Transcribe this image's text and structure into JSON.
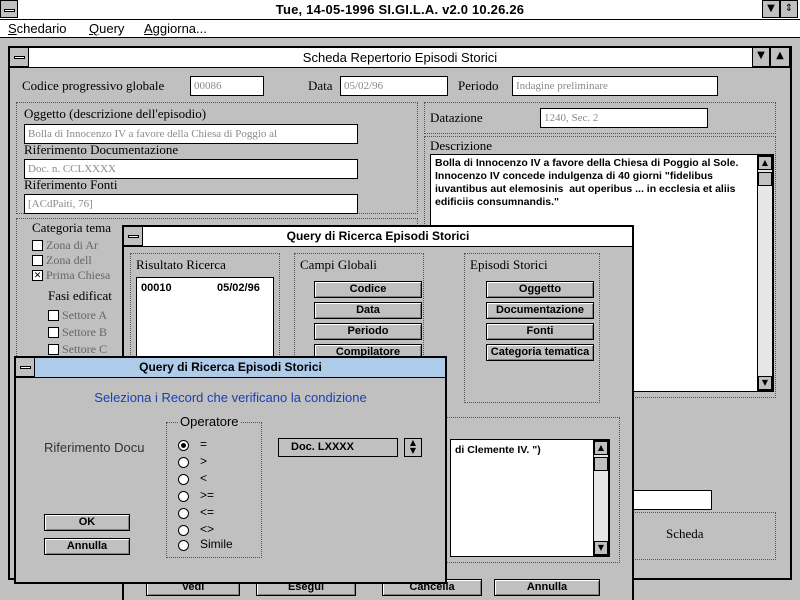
{
  "app": {
    "title": "Tue, 14-05-1996   SI.GI.L.A.  v2.0   10.26.26"
  },
  "menu": [
    "Schedario",
    "Query",
    "Aggiorna..."
  ],
  "main": {
    "title": "Scheda Repertorio Episodi Storici",
    "codice_label": "Codice progressivo globale",
    "codice_value": "00086",
    "data_label": "Data",
    "data_value": "05/02/96",
    "periodo_label": "Periodo",
    "periodo_value": "Indagine preliminare",
    "oggetto_label": "Oggetto (descrizione dell'episodio)",
    "oggetto_value": "Bolla di Innocenzo IV a favore della Chiesa di Poggio al",
    "rif_doc_label": "Riferimento Documentazione",
    "rif_doc_value": "Doc. n. CCLXXXX",
    "rif_fonti_label": "Riferimento Fonti",
    "rif_fonti_value": "[ACdPaiti, 76]",
    "datazione_label": "Datazione",
    "datazione_value": "1240, Sec. 2",
    "descrizione_label": "Descrizione",
    "descrizione_text": "Bolla di Innocenzo IV a favore della Chiesa di Poggio al Sole.\nInnocenzo IV concede indulgenza di 40 giorni \"fidelibus iuvantibus aut elemosinis  aut operibus ... in ecclesia et aliis edificiis consumnandis.\"",
    "categoria_label": "Categoria tema",
    "categorie": [
      {
        "label": "Zona di Ar",
        "checked": false
      },
      {
        "label": "Zona dell",
        "checked": false
      },
      {
        "label": "Prima Chiesa",
        "checked": true
      }
    ],
    "fasi_label": "Fasi edificat",
    "settori": [
      "Settore A",
      "Settore B",
      "Settore C"
    ],
    "scheda_label": "Scheda"
  },
  "query1": {
    "title": "Query di Ricerca Episodi Storici",
    "risultato_label": "Risultato Ricerca",
    "risultato_items": [
      {
        "code": "00010",
        "date": "05/02/96"
      }
    ],
    "campi_globali_label": "Campi Globali",
    "campi_globali_buttons": [
      "Codice",
      "Data",
      "Periodo",
      "Compilatore"
    ],
    "episodi_label": "Episodi Storici",
    "episodi_buttons": [
      "Oggetto",
      "Documentazione",
      "Fonti",
      "Categoria tematica"
    ],
    "condition_text": "di Clemente IV. \")",
    "bottom_buttons": [
      "Vedi",
      "Esegui",
      "Cancella",
      "Annulla"
    ]
  },
  "query2": {
    "title": "Query di Ricerca Episodi Storici",
    "prompt": "Seleziona i Record che verificano la condizione",
    "field_label": "Riferimento Docu",
    "operatore_label": "Operatore",
    "operators": [
      "=",
      ">",
      "<",
      ">=",
      "<=",
      "<>",
      "Simile"
    ],
    "selected_operator": 0,
    "value": "Doc. LXXXX",
    "ok_label": "OK",
    "cancel_label": "Annulla"
  },
  "colors": {
    "window_bg": "#c0c0c0",
    "title_active": "#aecbea",
    "prompt_blue": "#1a3fae"
  }
}
